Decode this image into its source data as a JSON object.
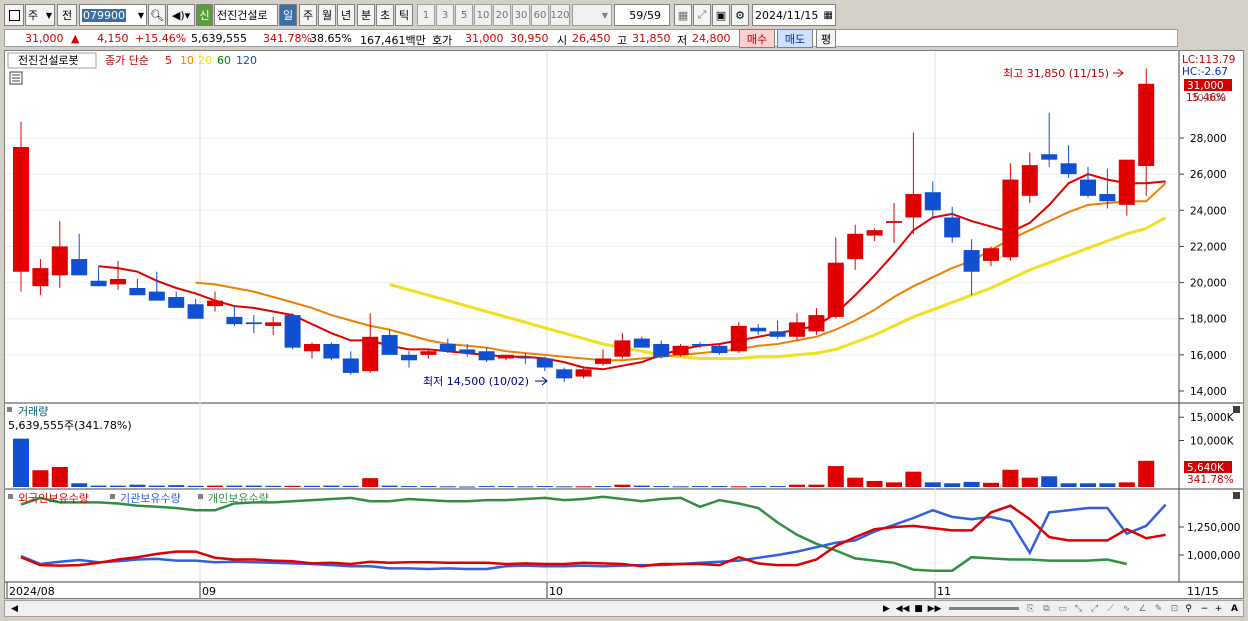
{
  "toolbar": {
    "market_select": "주",
    "prefix_btn": "전",
    "code_value": "079900",
    "stock_badge": "신",
    "stock_name": "전진건설로",
    "periods": [
      "일",
      "주",
      "월",
      "년",
      "분",
      "초",
      "틱"
    ],
    "active_period": "일",
    "intervals": [
      "1",
      "3",
      "5",
      "10",
      "20",
      "30",
      "60",
      "120"
    ],
    "count_value": "59/59",
    "date_value": "2024/11/15"
  },
  "quote": {
    "price": "31,000",
    "change": "4,150",
    "change_pct": "+15.46%",
    "volume": "5,639,555",
    "vol_ratio": "341.78%",
    "turnover": "38.65%",
    "amount": "167,461백만",
    "ask_label": "호가",
    "ask1": "31,000",
    "ask2": "30,950",
    "open_label": "시",
    "open": "26,450",
    "high_label": "고",
    "high": "31,850",
    "low_label": "저",
    "low": "24,800",
    "buy_label": "매수",
    "sell_label": "매도",
    "eval_label": "평"
  },
  "price_panel": {
    "name": "전진건설로봇",
    "ma_title": "종가 단순",
    "ma_periods": [
      "5",
      "10",
      "20",
      "60",
      "120"
    ],
    "ma_colors": [
      "#e00000",
      "#f08000",
      "#f0e000",
      "#008000",
      "#0050d0"
    ],
    "lc": "LC:113.79",
    "hc": "HC:-2.67",
    "last_price": "31,000",
    "last_pct": "15.46%",
    "hidden_tick": "30,000",
    "max_label": "최고 31,850 (11/15)",
    "min_label": "최저 14,500 (10/02)",
    "y_ticks": [
      "28,000",
      "26,000",
      "24,000",
      "22,000",
      "20,000",
      "18,000",
      "16,000",
      "14,000"
    ]
  },
  "volume_panel": {
    "title": "거래량",
    "info": "5,639,555주(341.78%)",
    "y_ticks": [
      "15,000K",
      "10,000K"
    ],
    "last_value": "5,640K",
    "last_pct": "341.78%"
  },
  "holdings_panel": {
    "legends": [
      "외국인보유수량",
      "기관보유수량",
      "개인보유수량"
    ],
    "legend_colors": [
      "#e00000",
      "#3060e0",
      "#309040"
    ],
    "y_ticks": [
      "1,250,000",
      "1,000,000"
    ]
  },
  "x_axis": {
    "labels": [
      "2024/08",
      "09",
      "10",
      "11"
    ],
    "right_label": "11/15"
  },
  "chart_data": {
    "type": "candlestick",
    "title": "전진건설로봇",
    "ylim": [
      13500,
      32500
    ],
    "candles": [
      {
        "o": 20600,
        "h": 28900,
        "l": 19500,
        "c": 27500
      },
      {
        "o": 19800,
        "h": 21300,
        "l": 19300,
        "c": 20800
      },
      {
        "o": 20400,
        "h": 23400,
        "l": 19700,
        "c": 22000
      },
      {
        "o": 21300,
        "h": 22700,
        "l": 20500,
        "c": 20400
      },
      {
        "o": 20100,
        "h": 20900,
        "l": 19800,
        "c": 19800
      },
      {
        "o": 19900,
        "h": 21200,
        "l": 19600,
        "c": 20200
      },
      {
        "o": 19700,
        "h": 20200,
        "l": 19400,
        "c": 19300
      },
      {
        "o": 19500,
        "h": 20600,
        "l": 19200,
        "c": 19000
      },
      {
        "o": 19200,
        "h": 19500,
        "l": 18800,
        "c": 18600
      },
      {
        "o": 18800,
        "h": 19100,
        "l": 18000,
        "c": 18000
      },
      {
        "o": 18700,
        "h": 19500,
        "l": 18400,
        "c": 19000
      },
      {
        "o": 18100,
        "h": 18700,
        "l": 17600,
        "c": 17700
      },
      {
        "o": 17800,
        "h": 18200,
        "l": 17200,
        "c": 17700
      },
      {
        "o": 17600,
        "h": 18100,
        "l": 17100,
        "c": 17800
      },
      {
        "o": 18200,
        "h": 18300,
        "l": 16300,
        "c": 16400
      },
      {
        "o": 16200,
        "h": 16700,
        "l": 15800,
        "c": 16600
      },
      {
        "o": 16600,
        "h": 16700,
        "l": 15700,
        "c": 15800
      },
      {
        "o": 15800,
        "h": 16200,
        "l": 14900,
        "c": 15000
      },
      {
        "o": 15100,
        "h": 18300,
        "l": 15000,
        "c": 17000
      },
      {
        "o": 17100,
        "h": 17400,
        "l": 16000,
        "c": 16000
      },
      {
        "o": 16000,
        "h": 16200,
        "l": 15300,
        "c": 15700
      },
      {
        "o": 16000,
        "h": 16300,
        "l": 15800,
        "c": 16200
      },
      {
        "o": 16600,
        "h": 16900,
        "l": 16100,
        "c": 16200
      },
      {
        "o": 16300,
        "h": 16600,
        "l": 15900,
        "c": 16100
      },
      {
        "o": 16200,
        "h": 16400,
        "l": 15600,
        "c": 15700
      },
      {
        "o": 15800,
        "h": 16000,
        "l": 15700,
        "c": 16000
      },
      {
        "o": 15900,
        "h": 16100,
        "l": 15500,
        "c": 15800
      },
      {
        "o": 15800,
        "h": 15900,
        "l": 15100,
        "c": 15300
      },
      {
        "o": 15200,
        "h": 15300,
        "l": 14500,
        "c": 14700
      },
      {
        "o": 14800,
        "h": 15300,
        "l": 14700,
        "c": 15200
      },
      {
        "o": 15500,
        "h": 16300,
        "l": 15400,
        "c": 15800
      },
      {
        "o": 15900,
        "h": 17200,
        "l": 15800,
        "c": 16800
      },
      {
        "o": 16900,
        "h": 17000,
        "l": 16400,
        "c": 16400
      },
      {
        "o": 16600,
        "h": 16800,
        "l": 15800,
        "c": 15900
      },
      {
        "o": 16000,
        "h": 16600,
        "l": 15900,
        "c": 16500
      },
      {
        "o": 16600,
        "h": 16700,
        "l": 16400,
        "c": 16500
      },
      {
        "o": 16500,
        "h": 16600,
        "l": 16000,
        "c": 16100
      },
      {
        "o": 16200,
        "h": 17800,
        "l": 16100,
        "c": 17600
      },
      {
        "o": 17500,
        "h": 17700,
        "l": 17100,
        "c": 17300
      },
      {
        "o": 17300,
        "h": 17900,
        "l": 16900,
        "c": 17000
      },
      {
        "o": 17000,
        "h": 18300,
        "l": 16800,
        "c": 17800
      },
      {
        "o": 17300,
        "h": 18600,
        "l": 17100,
        "c": 18200
      },
      {
        "o": 18100,
        "h": 22500,
        "l": 18000,
        "c": 21100
      },
      {
        "o": 21300,
        "h": 23200,
        "l": 20700,
        "c": 22700
      },
      {
        "o": 22600,
        "h": 23000,
        "l": 22300,
        "c": 22900
      },
      {
        "o": 23300,
        "h": 24400,
        "l": 22200,
        "c": 23400
      },
      {
        "o": 23600,
        "h": 28300,
        "l": 22700,
        "c": 24900
      },
      {
        "o": 25000,
        "h": 25600,
        "l": 23600,
        "c": 24000
      },
      {
        "o": 23600,
        "h": 24200,
        "l": 22200,
        "c": 22500
      },
      {
        "o": 21800,
        "h": 22400,
        "l": 19300,
        "c": 20600
      },
      {
        "o": 21200,
        "h": 22000,
        "l": 20900,
        "c": 21900
      },
      {
        "o": 21400,
        "h": 26600,
        "l": 21200,
        "c": 25700
      },
      {
        "o": 24800,
        "h": 27200,
        "l": 24400,
        "c": 26500
      },
      {
        "o": 27100,
        "h": 29400,
        "l": 26400,
        "c": 26800
      },
      {
        "o": 26600,
        "h": 27600,
        "l": 25800,
        "c": 26000
      },
      {
        "o": 25700,
        "h": 26400,
        "l": 24700,
        "c": 24800
      },
      {
        "o": 24900,
        "h": 26300,
        "l": 24100,
        "c": 24500
      },
      {
        "o": 24300,
        "h": 26800,
        "l": 23700,
        "c": 26800
      },
      {
        "o": 26450,
        "h": 31850,
        "l": 24800,
        "c": 31000
      }
    ],
    "ma5": [
      null,
      null,
      null,
      null,
      20900,
      20800,
      20600,
      20100,
      19700,
      19400,
      19000,
      18700,
      18600,
      18400,
      18200,
      17700,
      17200,
      16800,
      16800,
      16500,
      16300,
      16300,
      16200,
      16100,
      16000,
      15900,
      15900,
      15800,
      15600,
      15300,
      15200,
      15400,
      15600,
      16000,
      16300,
      16500,
      16600,
      16800,
      17000,
      17200,
      17400,
      17600,
      18300,
      19300,
      20400,
      21600,
      22900,
      23600,
      23800,
      23400,
      23100,
      22800,
      23300,
      24300,
      25500,
      26000,
      25700,
      25500,
      25500,
      25600
    ],
    "ma10": [
      null,
      null,
      null,
      null,
      null,
      null,
      null,
      null,
      null,
      20000,
      19900,
      19700,
      19500,
      19200,
      18900,
      18600,
      18200,
      17900,
      17600,
      17400,
      17100,
      16800,
      16600,
      16500,
      16400,
      16200,
      16100,
      16000,
      15900,
      15800,
      15700,
      15700,
      15800,
      15900,
      16000,
      16100,
      16200,
      16300,
      16500,
      16600,
      16800,
      17000,
      17400,
      17900,
      18500,
      19200,
      19800,
      20300,
      20800,
      21200,
      21800,
      22400,
      22900,
      23400,
      23900,
      24300,
      24400,
      24500,
      24500,
      25500
    ],
    "ma20": [
      null,
      null,
      null,
      null,
      null,
      null,
      null,
      null,
      null,
      null,
      null,
      null,
      null,
      null,
      null,
      null,
      null,
      null,
      null,
      19900,
      19600,
      19300,
      19000,
      18700,
      18400,
      18100,
      17800,
      17500,
      17200,
      16900,
      16600,
      16400,
      16200,
      16000,
      15900,
      15800,
      15800,
      15800,
      15900,
      15900,
      16000,
      16100,
      16300,
      16700,
      17100,
      17600,
      18100,
      18500,
      18900,
      19300,
      19700,
      20200,
      20700,
      21100,
      21500,
      21900,
      22300,
      22700,
      23000,
      23600
    ],
    "volume_k": [
      10400,
      3600,
      4300,
      800,
      300,
      300,
      500,
      300,
      400,
      250,
      300,
      300,
      300,
      250,
      250,
      250,
      300,
      250,
      1900,
      300,
      200,
      200,
      150,
      100,
      200,
      200,
      150,
      200,
      150,
      150,
      200,
      500,
      300,
      200,
      150,
      200,
      200,
      150,
      200,
      200,
      500,
      500,
      4500,
      2000,
      1300,
      1000,
      3300,
      1000,
      800,
      1100,
      900,
      3700,
      2000,
      2300,
      800,
      800,
      800,
      1000,
      5640
    ],
    "vol_up": [
      false,
      true,
      true,
      false,
      false,
      false,
      false,
      false,
      false,
      false,
      true,
      false,
      false,
      false,
      true,
      false,
      false,
      false,
      true,
      false,
      false,
      false,
      false,
      false,
      false,
      false,
      false,
      false,
      false,
      true,
      false,
      true,
      false,
      false,
      false,
      false,
      false,
      true,
      false,
      false,
      true,
      true,
      true,
      true,
      true,
      true,
      true,
      false,
      false,
      false,
      true,
      true,
      true,
      false,
      false,
      false,
      false,
      true,
      true
    ],
    "foreign": [
      980,
      910,
      905,
      910,
      930,
      960,
      980,
      1010,
      1030,
      1030,
      975,
      960,
      960,
      950,
      945,
      925,
      930,
      920,
      940,
      930,
      935,
      935,
      930,
      930,
      930,
      920,
      925,
      920,
      920,
      930,
      925,
      920,
      900,
      920,
      920,
      920,
      910,
      980,
      925,
      910,
      910,
      960,
      1080,
      1160,
      1230,
      1250,
      1260,
      1240,
      1220,
      1220,
      1380,
      1440,
      1320,
      1160,
      1130,
      1130,
      1130,
      1230,
      1150,
      1180
    ],
    "institution": [
      990,
      920,
      940,
      955,
      935,
      945,
      960,
      965,
      950,
      950,
      935,
      940,
      935,
      930,
      925,
      920,
      910,
      900,
      900,
      880,
      880,
      875,
      880,
      875,
      875,
      900,
      905,
      900,
      900,
      905,
      900,
      905,
      910,
      910,
      920,
      930,
      940,
      950,
      975,
      1000,
      1030,
      1070,
      1110,
      1130,
      1210,
      1270,
      1330,
      1400,
      1340,
      1320,
      1340,
      1300,
      1020,
      1380,
      1400,
      1420,
      1420,
      1190,
      1260,
      1450
    ],
    "individual": [
      1450,
      1510,
      1470,
      1470,
      1470,
      1460,
      1440,
      1430,
      1420,
      1400,
      1400,
      1460,
      1470,
      1470,
      1480,
      1490,
      1500,
      1510,
      1480,
      1480,
      1500,
      1490,
      1480,
      1480,
      1490,
      1490,
      1500,
      1510,
      1490,
      1500,
      1520,
      1500,
      1480,
      1500,
      1510,
      1430,
      1490,
      1460,
      1420,
      1290,
      1180,
      1100,
      1040,
      970,
      950,
      930,
      870,
      860,
      860,
      980,
      970,
      960,
      960,
      950,
      950,
      950,
      960,
      920
    ]
  }
}
